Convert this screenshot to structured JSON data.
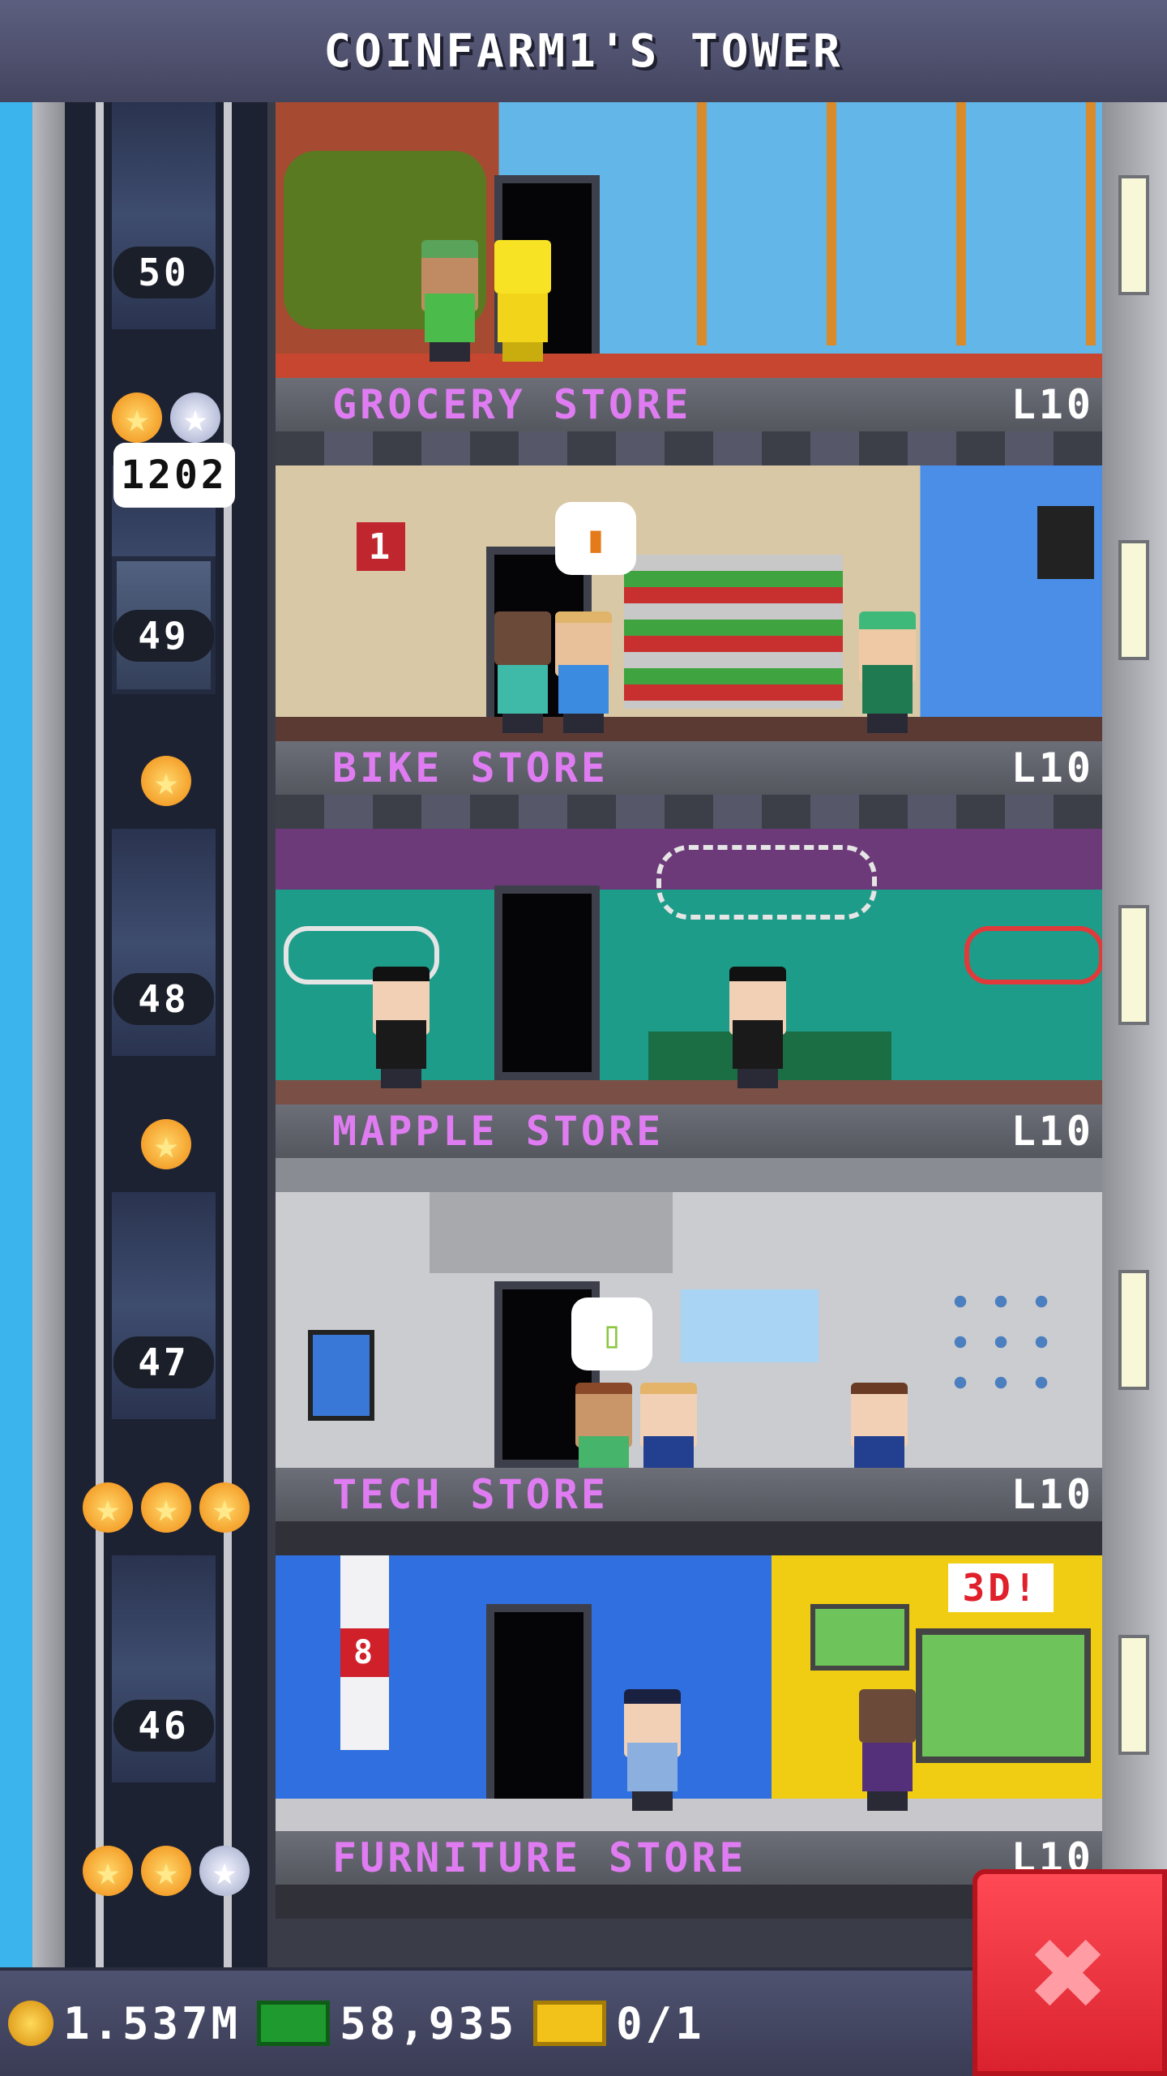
{
  "header": {
    "title": "COINFARM1'S TOWER"
  },
  "elevator": {
    "passenger_bubble": "1202",
    "floor_numbers": [
      "50",
      "49",
      "48",
      "47",
      "46"
    ],
    "rows": [
      {
        "stars": [
          "gold",
          "silver"
        ]
      },
      {
        "stars": [
          "gold"
        ]
      },
      {
        "stars": [
          "gold"
        ]
      },
      {
        "stars": [
          "gold",
          "gold",
          "gold"
        ]
      },
      {
        "stars": [
          "gold",
          "gold",
          "silver"
        ]
      }
    ]
  },
  "floors": [
    {
      "name": "GROCERY STORE",
      "level": "L10",
      "bg": "#b7553a"
    },
    {
      "name": "BIKE STORE",
      "level": "L10",
      "bg": "#d8c9ae"
    },
    {
      "name": "MAPPLE STORE",
      "level": "L10",
      "bg": "#1d9c8a"
    },
    {
      "name": "TECH STORE",
      "level": "L10",
      "bg": "#c9cacd"
    },
    {
      "name": "FURNITURE STORE",
      "level": "L10",
      "bg": "#2f6fe0"
    }
  ],
  "room_details": {
    "bike_store_sign": "1",
    "furniture_badge": "8",
    "furniture_display": "3D!"
  },
  "resources": {
    "coins": "1.537M",
    "bux": "58,935",
    "tickets": "0/1"
  },
  "close_button": {
    "label": "✖"
  },
  "colors": {
    "floor_name": "#e07cf2",
    "header_bg": "#4d4f6c",
    "close_button": "#e4262f"
  }
}
